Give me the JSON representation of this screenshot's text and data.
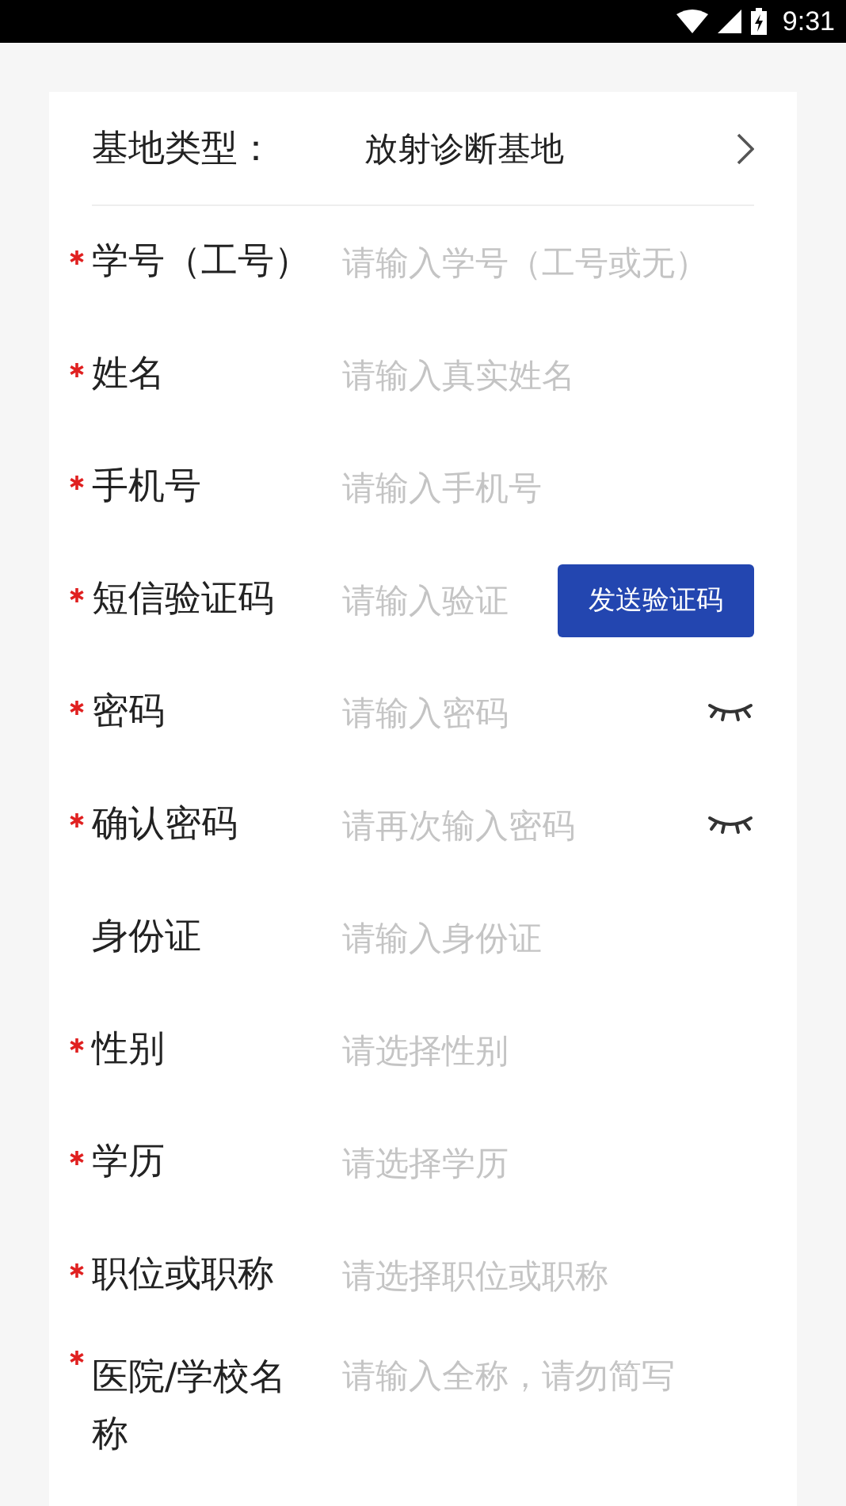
{
  "status_bar": {
    "time": "9:31"
  },
  "base_type": {
    "label": "基地类型：",
    "value": "放射诊断基地"
  },
  "fields": [
    {
      "kind": "text",
      "required": true,
      "label": "学号（工号）",
      "placeholder": "请输入学号（工号或无）"
    },
    {
      "kind": "text",
      "required": true,
      "label": "姓名",
      "placeholder": "请输入真实姓名"
    },
    {
      "kind": "text",
      "required": true,
      "label": "手机号",
      "placeholder": "请输入手机号"
    },
    {
      "kind": "code",
      "required": true,
      "label": "短信验证码",
      "placeholder": "请输入验证",
      "button": "发送验证码"
    },
    {
      "kind": "password",
      "required": true,
      "label": "密码",
      "placeholder": "请输入密码"
    },
    {
      "kind": "password",
      "required": true,
      "label": "确认密码",
      "placeholder": "请再次输入密码"
    },
    {
      "kind": "text",
      "required": false,
      "label": "身份证",
      "placeholder": "请输入身份证"
    },
    {
      "kind": "select",
      "required": true,
      "label": "性别",
      "placeholder": "请选择性别"
    },
    {
      "kind": "select",
      "required": true,
      "label": "学历",
      "placeholder": "请选择学历"
    },
    {
      "kind": "select",
      "required": true,
      "label": "职位或职称",
      "placeholder": "请选择职位或职称"
    },
    {
      "kind": "text",
      "required": true,
      "label": "医院/学校名称",
      "placeholder": "请输入全称，请勿简写"
    }
  ]
}
